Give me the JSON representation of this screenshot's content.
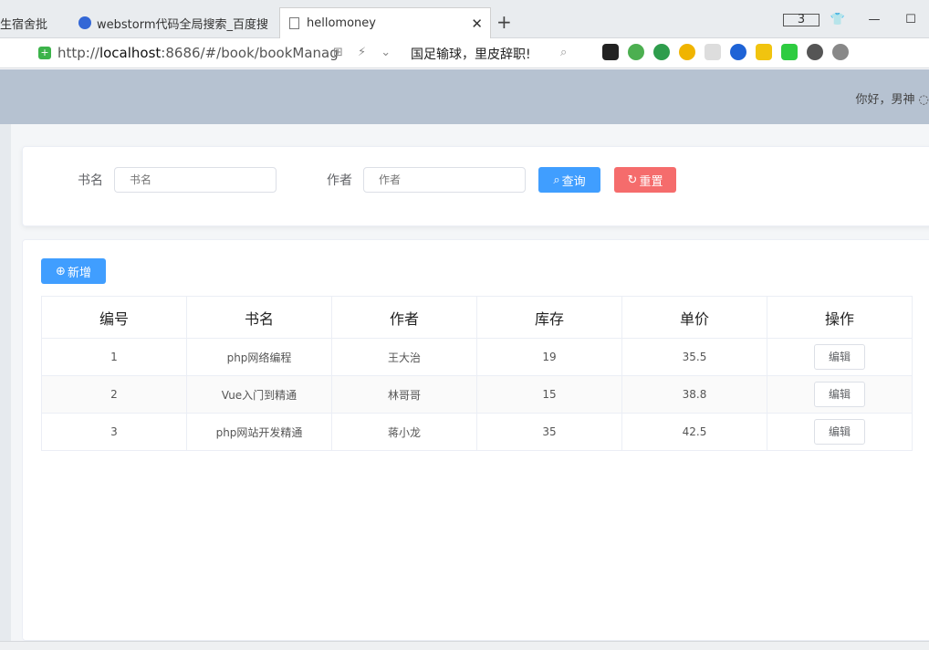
{
  "browser": {
    "tabs": [
      {
        "label": "生宿舍批"
      },
      {
        "label": "webstorm代码全局搜索_百度搜"
      },
      {
        "label": "hellomoney"
      }
    ],
    "tab_count_badge": "3",
    "url_prefix": "http://",
    "url_host": "localhost",
    "url_rest": ":8686/#/book/bookManag",
    "news_text": "国足输球，里皮辞职!"
  },
  "header": {
    "greeting": "你好，男神 ◌"
  },
  "search": {
    "name_label": "书名",
    "name_placeholder": "书名",
    "author_label": "作者",
    "author_placeholder": "作者",
    "search_button": "查询",
    "reset_button": "重置"
  },
  "table": {
    "add_button": "新增",
    "columns": [
      "编号",
      "书名",
      "作者",
      "库存",
      "单价",
      "操作"
    ],
    "rows": [
      {
        "id": "1",
        "name": "php网络编程",
        "author": "王大治",
        "stock": "19",
        "price": "35.5",
        "action": "编辑"
      },
      {
        "id": "2",
        "name": "Vue入门到精通",
        "author": "林哥哥",
        "stock": "15",
        "price": "38.8",
        "action": "编辑"
      },
      {
        "id": "3",
        "name": "php网站开发精通",
        "author": "蒋小龙",
        "stock": "35",
        "price": "42.5",
        "action": "编辑"
      }
    ]
  },
  "colors": {
    "primary": "#409eff",
    "danger": "#f56c6c",
    "header_bg": "#b6c2d1"
  }
}
